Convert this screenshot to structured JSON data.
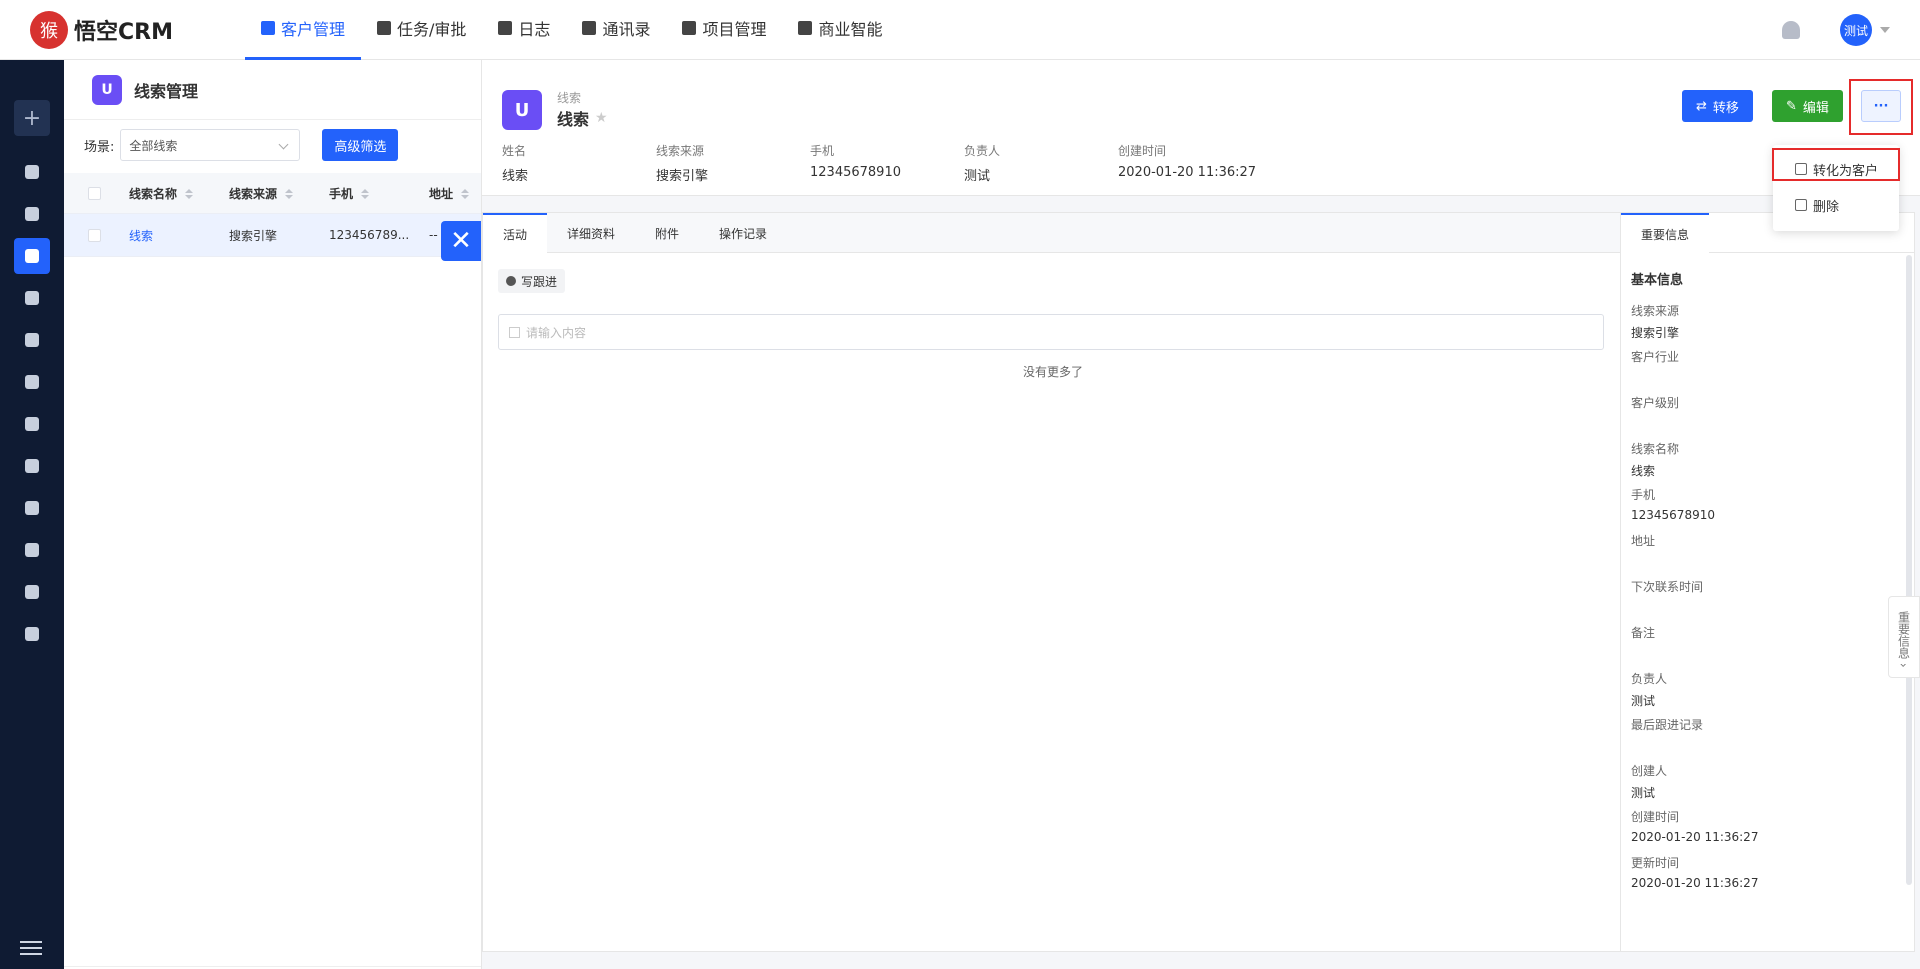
{
  "app": {
    "logo_text": "悟空CRM",
    "logo_glyph": "猴"
  },
  "nav": [
    {
      "label": "客户管理",
      "icon": "customer-icon",
      "active": true
    },
    {
      "label": "任务/审批",
      "icon": "briefcase-icon"
    },
    {
      "label": "日志",
      "icon": "log-icon"
    },
    {
      "label": "通讯录",
      "icon": "phone-book-icon"
    },
    {
      "label": "项目管理",
      "icon": "project-icon"
    },
    {
      "label": "商业智能",
      "icon": "bi-icon"
    }
  ],
  "user": {
    "avatar": "测试"
  },
  "sidebar": {
    "add": "+",
    "icons": [
      "dashboard-icon",
      "chat-icon",
      "leads-icon",
      "building-icon",
      "contact-icon",
      "contacts-book-icon",
      "opportunity-icon",
      "money-icon",
      "contract-icon",
      "payment-icon",
      "product-icon",
      "send-icon"
    ]
  },
  "list": {
    "title": "线索管理",
    "icon_glyph": "U",
    "scene_label": "场景:",
    "scene_value": "全部线索",
    "filter_button": "高级筛选",
    "columns": [
      "线索名称",
      "线索来源",
      "手机",
      "地址"
    ],
    "rows": [
      {
        "name": "线索",
        "source": "搜索引擎",
        "phone": "123456789...",
        "address": "--"
      }
    ]
  },
  "detail": {
    "subtitle": "线索",
    "title": "线索",
    "fields": [
      {
        "k": "姓名",
        "v": "线索"
      },
      {
        "k": "线索来源",
        "v": "搜索引擎"
      },
      {
        "k": "手机",
        "v": "12345678910"
      },
      {
        "k": "负责人",
        "v": "测试"
      },
      {
        "k": "创建时间",
        "v": "2020-01-20 11:36:27"
      }
    ],
    "buttons": {
      "transfer": "转移",
      "edit": "编辑",
      "more": "···"
    },
    "menu": {
      "convert": "转化为客户",
      "delete": "删除"
    },
    "tabs": [
      "活动",
      "详细资料",
      "附件",
      "操作记录"
    ],
    "follow_button": "写跟进",
    "input_placeholder": "请输入内容",
    "no_more": "没有更多了"
  },
  "side": {
    "tab": "重要信息",
    "section": "基本信息",
    "items": [
      {
        "k": "线索来源",
        "v": "搜索引擎"
      },
      {
        "k": "客户行业",
        "v": ""
      },
      {
        "k": "客户级别",
        "v": ""
      },
      {
        "k": "线索名称",
        "v": "线索"
      },
      {
        "k": "手机",
        "v": "12345678910"
      },
      {
        "k": "地址",
        "v": ""
      },
      {
        "k": "下次联系时间",
        "v": ""
      },
      {
        "k": "备注",
        "v": ""
      },
      {
        "k": "负责人",
        "v": "测试"
      },
      {
        "k": "最后跟进记录",
        "v": ""
      },
      {
        "k": "创建人",
        "v": "测试"
      },
      {
        "k": "创建时间",
        "v": "2020-01-20 11:36:27"
      },
      {
        "k": "更新时间",
        "v": "2020-01-20 11:36:27"
      }
    ],
    "float_tab": "重要信息 ›"
  }
}
